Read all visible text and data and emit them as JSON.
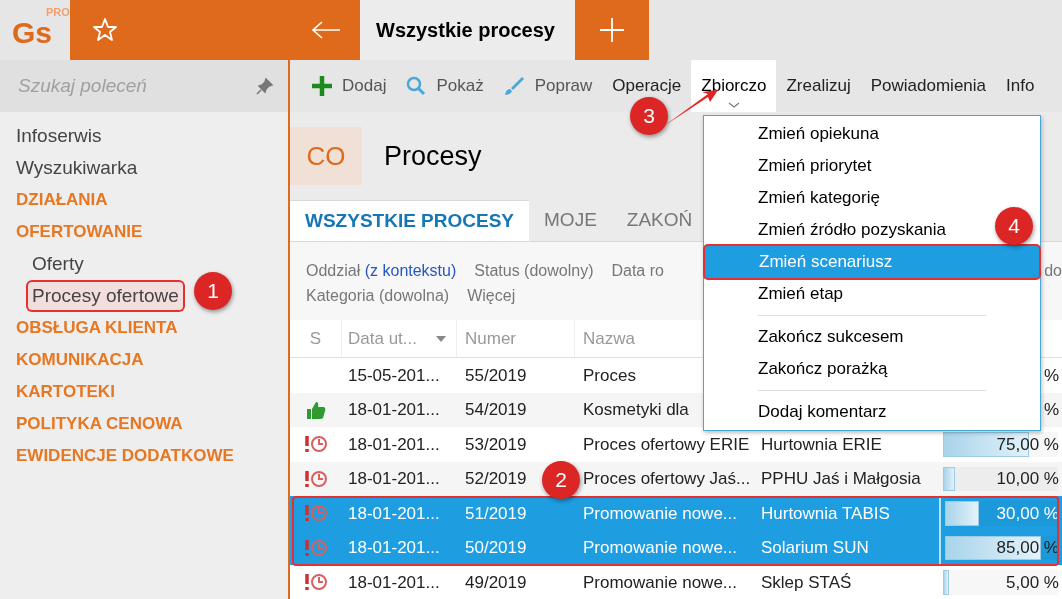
{
  "app": {
    "logo": "Gs",
    "logo_badge": "PRO"
  },
  "tab": {
    "title": "Wszystkie procesy"
  },
  "search": {
    "placeholder": "Szukaj poleceń"
  },
  "sidebar": {
    "items": [
      {
        "label": "Infoserwis",
        "kind": "link",
        "selected": false
      },
      {
        "label": "Wyszukiwarka",
        "kind": "link",
        "selected": false
      },
      {
        "label": "DZIAŁANIA",
        "kind": "section",
        "selected": false
      },
      {
        "label": "OFERTOWANIE",
        "kind": "section",
        "selected": false,
        "children": [
          {
            "label": "Oferty",
            "kind": "link",
            "selected": false
          },
          {
            "label": "Procesy ofertowe",
            "kind": "link",
            "selected": true
          }
        ]
      },
      {
        "label": "OBSŁUGA KLIENTA",
        "kind": "section",
        "selected": false
      },
      {
        "label": "KOMUNIKACJA",
        "kind": "section",
        "selected": false
      },
      {
        "label": "KARTOTEKI",
        "kind": "section",
        "selected": false
      },
      {
        "label": "POLITYKA CENOWA",
        "kind": "section",
        "selected": false
      },
      {
        "label": "EWIDENCJE DODATKOWE",
        "kind": "section",
        "selected": false
      }
    ]
  },
  "toolbar": [
    {
      "label": "Dodaj",
      "kind": "add",
      "open": false
    },
    {
      "label": "Pokaż",
      "kind": "show",
      "open": false
    },
    {
      "label": "Popraw",
      "kind": "edit",
      "open": false
    },
    {
      "label": "Operacje",
      "kind": "text",
      "open": false
    },
    {
      "label": "Zbiorczo",
      "kind": "text",
      "open": true
    },
    {
      "label": "Zrealizuj",
      "kind": "text",
      "open": false
    },
    {
      "label": "Powiadomienia",
      "kind": "text",
      "open": false
    },
    {
      "label": "Info",
      "kind": "text",
      "open": false
    }
  ],
  "header": {
    "badge": "CO",
    "title": "Procesy"
  },
  "view_tabs": [
    {
      "label": "WSZYSTKIE PROCESY",
      "selected": true
    },
    {
      "label": "MOJE",
      "selected": false
    },
    {
      "label": "ZAKOŃ",
      "selected": false
    }
  ],
  "filters": [
    {
      "text": "Oddział **(z kontekstu)**"
    },
    {
      "text": "Status (dowolny)"
    },
    {
      "text": "Data ro"
    },
    {
      "text": "do"
    },
    {
      "text": "Kategoria (dowolna)"
    },
    {
      "text": "Więcej"
    }
  ],
  "table": {
    "columns": [
      "S",
      "Data ut...",
      "Numer",
      "Nazwa"
    ],
    "rows": [
      {
        "kind": "none",
        "date": "15-05-201...",
        "number": "55/2019",
        "name": "Proces",
        "client": "",
        "percent": "%",
        "selected": false
      },
      {
        "kind": "thumb",
        "date": "18-01-201...",
        "number": "54/2019",
        "name": "Kosmetyki dla",
        "client": "",
        "percent": "%",
        "selected": false
      },
      {
        "kind": "overdue",
        "date": "18-01-201...",
        "number": "53/2019",
        "name": "Proces ofertowy ERIE",
        "client": "Hurtownia ERIE",
        "percent": "75,00 %",
        "level": 0.75,
        "selected": false
      },
      {
        "kind": "overdue",
        "date": "18-01-201...",
        "number": "52/2019",
        "name": "Proces ofertowy Jaś...",
        "client": "PPHU Jaś i Małgosia",
        "percent": "10,00 %",
        "level": 0.1,
        "selected": false
      },
      {
        "kind": "overdue",
        "date": "18-01-201...",
        "number": "51/2019",
        "name": "Promowanie nowe...",
        "client": "Hurtownia TABIS",
        "percent": "30,00 %",
        "level": 0.3,
        "selected": true
      },
      {
        "kind": "overdue",
        "date": "18-01-201...",
        "number": "50/2019",
        "name": "Promowanie nowe...",
        "client": "Solarium SUN",
        "percent": "85,00 %",
        "level": 0.85,
        "selected": true
      },
      {
        "kind": "overdue",
        "date": "18-01-201...",
        "number": "49/2019",
        "name": "Promowanie nowe...",
        "client": "Sklep STAŚ",
        "percent": "5,00 %",
        "level": 0.05,
        "selected": false
      }
    ]
  },
  "menu": {
    "items": [
      {
        "label": "Zmień opiekuna",
        "kind": "item",
        "selected": false
      },
      {
        "label": "Zmień priorytet",
        "kind": "item",
        "selected": false
      },
      {
        "label": "Zmień kategorię",
        "kind": "item",
        "selected": false
      },
      {
        "label": "Zmień źródło pozyskania",
        "kind": "item",
        "selected": false
      },
      {
        "label": "Zmień scenariusz",
        "kind": "item",
        "selected": true
      },
      {
        "label": "Zmień etap",
        "kind": "item",
        "selected": false
      },
      {
        "kind": "separator"
      },
      {
        "label": "Zakończ sukcesem",
        "kind": "item",
        "selected": false
      },
      {
        "label": "Zakończ porażką",
        "kind": "item",
        "selected": false
      },
      {
        "kind": "separator"
      },
      {
        "label": "Dodaj komentarz",
        "kind": "item",
        "selected": false
      }
    ]
  },
  "annotations": [
    {
      "label": "1"
    },
    {
      "label": "2"
    },
    {
      "label": "3"
    },
    {
      "label": "4"
    }
  ]
}
